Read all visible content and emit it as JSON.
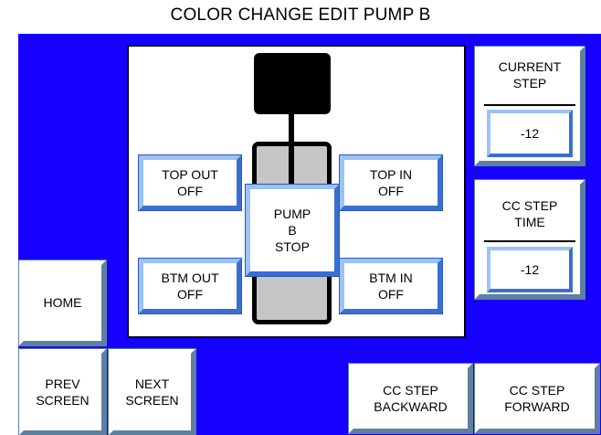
{
  "title": "COLOR CHANGE EDIT PUMP B",
  "valves": {
    "top_out": "TOP OUT\nOFF",
    "top_in": "TOP IN\nOFF",
    "btm_out": "BTM OUT\nOFF",
    "btm_in": "BTM IN\nOFF"
  },
  "pump_status": "PUMP\nB\nSTOP",
  "current_step": {
    "label": "CURRENT\nSTEP",
    "value": "-12"
  },
  "cc_step_time": {
    "label": "CC STEP\nTIME",
    "value": "-12"
  },
  "nav": {
    "home": "HOME",
    "prev": "PREV\nSCREEN",
    "next": "NEXT\nSCREEN",
    "backward": "CC STEP\nBACKWARD",
    "forward": "CC STEP\nFORWARD"
  },
  "colors": {
    "background_blue": "#1600ff",
    "pump_gray": "#c6c6c6"
  }
}
